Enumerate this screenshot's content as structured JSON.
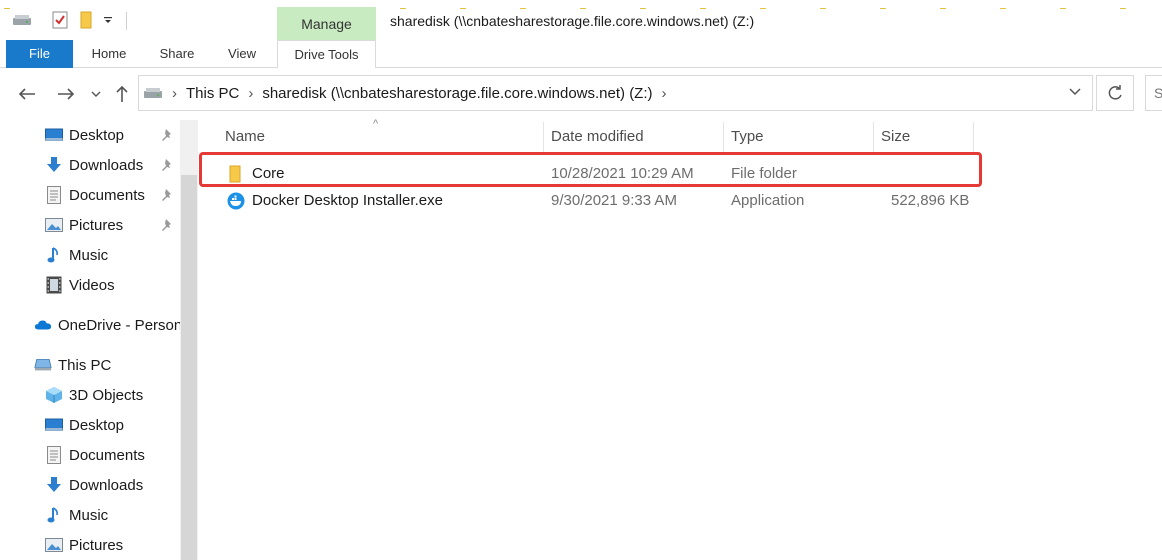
{
  "window": {
    "title": "sharedisk (\\\\cnbatesharestorage.file.core.windows.net) (Z:)",
    "context_group_label": "Manage"
  },
  "ribbon": {
    "tabs": [
      "File",
      "Home",
      "Share",
      "View",
      "Drive Tools"
    ]
  },
  "address_bar": {
    "crumbs": [
      "This PC",
      "sharedisk (\\\\cnbatesharestorage.file.core.windows.net) (Z:)"
    ],
    "search_placeholder": "S"
  },
  "sidebar": {
    "quick_access": [
      {
        "label": "Desktop",
        "icon": "desktop-icon",
        "pinned": true
      },
      {
        "label": "Downloads",
        "icon": "downloads-icon",
        "pinned": true
      },
      {
        "label": "Documents",
        "icon": "documents-icon",
        "pinned": true
      },
      {
        "label": "Pictures",
        "icon": "pictures-icon",
        "pinned": true
      },
      {
        "label": "Music",
        "icon": "music-icon",
        "pinned": false
      },
      {
        "label": "Videos",
        "icon": "videos-icon",
        "pinned": false
      }
    ],
    "onedrive": {
      "label": "OneDrive - Person",
      "icon": "onedrive-icon"
    },
    "this_pc": {
      "label": "This PC",
      "icon": "this-pc-icon",
      "children": [
        {
          "label": "3D Objects",
          "icon": "3d-objects-icon"
        },
        {
          "label": "Desktop",
          "icon": "desktop-icon"
        },
        {
          "label": "Documents",
          "icon": "documents-icon"
        },
        {
          "label": "Downloads",
          "icon": "downloads-icon"
        },
        {
          "label": "Music",
          "icon": "music-icon"
        },
        {
          "label": "Pictures",
          "icon": "pictures-icon"
        }
      ]
    }
  },
  "file_list": {
    "columns": [
      "Name",
      "Date modified",
      "Type",
      "Size"
    ],
    "rows": [
      {
        "name": "Core",
        "date": "10/28/2021 10:29 AM",
        "type": "File folder",
        "size": "",
        "icon": "folder-icon",
        "highlighted": true
      },
      {
        "name": "Docker Desktop Installer.exe",
        "date": "9/30/2021 9:33 AM",
        "type": "Application",
        "size": "522,896 KB",
        "icon": "docker-icon",
        "highlighted": false
      }
    ]
  },
  "colors": {
    "file_tab": "#1979ca",
    "manage_context": "#c9ebc2",
    "highlight_border": "#e53935",
    "folder": "#f7c948"
  }
}
